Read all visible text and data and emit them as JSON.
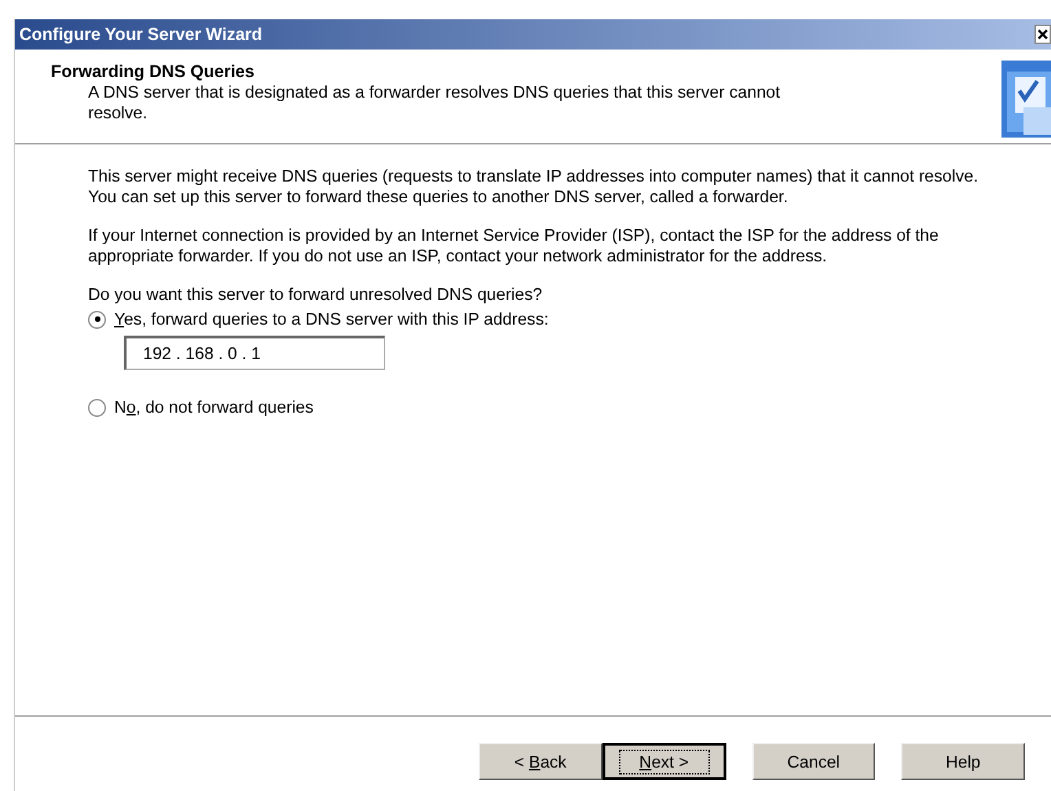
{
  "window": {
    "title": "Configure Your Server Wizard"
  },
  "header": {
    "title": "Forwarding DNS Queries",
    "subtitle": "A DNS server that is designated as a forwarder resolves DNS queries that this server cannot resolve."
  },
  "paragraphs": [
    "This server might receive DNS queries (requests to translate IP addresses into computer names) that it cannot resolve. You can set up this server to forward these queries to another DNS server, called a forwarder.",
    "If your Internet connection is provided by an Internet Service Provider (ISP), contact the ISP for the address of the appropriate forwarder. If you do not use an ISP, contact your network administrator for the address."
  ],
  "question": "Do you want this server to forward unresolved DNS queries?",
  "options": [
    {
      "access_key": "Y",
      "label_after": "es, forward queries to a DNS server with this IP address:",
      "selected": true,
      "ip_address": "192 . 168 . 0 . 1"
    },
    {
      "label_before": "N",
      "access_key": "o",
      "label_after": ", do not forward queries",
      "selected": false
    }
  ],
  "buttons": [
    {
      "label_before": "< ",
      "access_key": "B",
      "label_after": "ack",
      "focused": false
    },
    {
      "access_key": "N",
      "label_after": "ext >",
      "focused": true
    },
    {
      "label_before": "Cancel",
      "focused": false
    },
    {
      "label_before": "Help",
      "focused": false
    }
  ]
}
